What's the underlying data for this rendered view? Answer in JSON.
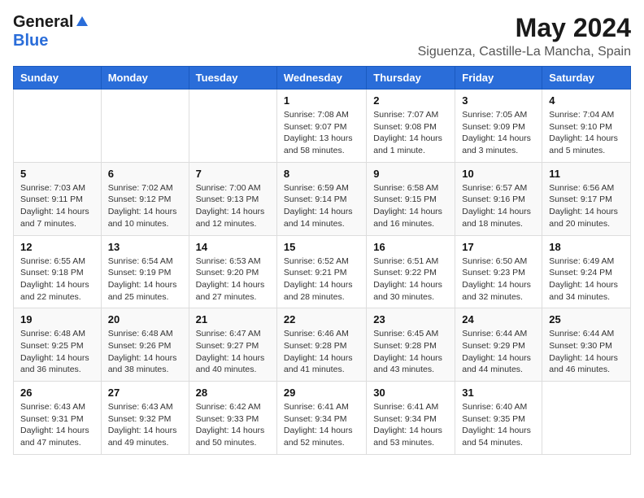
{
  "header": {
    "logo_general": "General",
    "logo_blue": "Blue",
    "month": "May 2024",
    "location": "Siguenza, Castille-La Mancha, Spain"
  },
  "days_of_week": [
    "Sunday",
    "Monday",
    "Tuesday",
    "Wednesday",
    "Thursday",
    "Friday",
    "Saturday"
  ],
  "weeks": [
    [
      {
        "day": "",
        "sunrise": "",
        "sunset": "",
        "daylight": ""
      },
      {
        "day": "",
        "sunrise": "",
        "sunset": "",
        "daylight": ""
      },
      {
        "day": "",
        "sunrise": "",
        "sunset": "",
        "daylight": ""
      },
      {
        "day": "1",
        "sunrise": "Sunrise: 7:08 AM",
        "sunset": "Sunset: 9:07 PM",
        "daylight": "Daylight: 13 hours and 58 minutes."
      },
      {
        "day": "2",
        "sunrise": "Sunrise: 7:07 AM",
        "sunset": "Sunset: 9:08 PM",
        "daylight": "Daylight: 14 hours and 1 minute."
      },
      {
        "day": "3",
        "sunrise": "Sunrise: 7:05 AM",
        "sunset": "Sunset: 9:09 PM",
        "daylight": "Daylight: 14 hours and 3 minutes."
      },
      {
        "day": "4",
        "sunrise": "Sunrise: 7:04 AM",
        "sunset": "Sunset: 9:10 PM",
        "daylight": "Daylight: 14 hours and 5 minutes."
      }
    ],
    [
      {
        "day": "5",
        "sunrise": "Sunrise: 7:03 AM",
        "sunset": "Sunset: 9:11 PM",
        "daylight": "Daylight: 14 hours and 7 minutes."
      },
      {
        "day": "6",
        "sunrise": "Sunrise: 7:02 AM",
        "sunset": "Sunset: 9:12 PM",
        "daylight": "Daylight: 14 hours and 10 minutes."
      },
      {
        "day": "7",
        "sunrise": "Sunrise: 7:00 AM",
        "sunset": "Sunset: 9:13 PM",
        "daylight": "Daylight: 14 hours and 12 minutes."
      },
      {
        "day": "8",
        "sunrise": "Sunrise: 6:59 AM",
        "sunset": "Sunset: 9:14 PM",
        "daylight": "Daylight: 14 hours and 14 minutes."
      },
      {
        "day": "9",
        "sunrise": "Sunrise: 6:58 AM",
        "sunset": "Sunset: 9:15 PM",
        "daylight": "Daylight: 14 hours and 16 minutes."
      },
      {
        "day": "10",
        "sunrise": "Sunrise: 6:57 AM",
        "sunset": "Sunset: 9:16 PM",
        "daylight": "Daylight: 14 hours and 18 minutes."
      },
      {
        "day": "11",
        "sunrise": "Sunrise: 6:56 AM",
        "sunset": "Sunset: 9:17 PM",
        "daylight": "Daylight: 14 hours and 20 minutes."
      }
    ],
    [
      {
        "day": "12",
        "sunrise": "Sunrise: 6:55 AM",
        "sunset": "Sunset: 9:18 PM",
        "daylight": "Daylight: 14 hours and 22 minutes."
      },
      {
        "day": "13",
        "sunrise": "Sunrise: 6:54 AM",
        "sunset": "Sunset: 9:19 PM",
        "daylight": "Daylight: 14 hours and 25 minutes."
      },
      {
        "day": "14",
        "sunrise": "Sunrise: 6:53 AM",
        "sunset": "Sunset: 9:20 PM",
        "daylight": "Daylight: 14 hours and 27 minutes."
      },
      {
        "day": "15",
        "sunrise": "Sunrise: 6:52 AM",
        "sunset": "Sunset: 9:21 PM",
        "daylight": "Daylight: 14 hours and 28 minutes."
      },
      {
        "day": "16",
        "sunrise": "Sunrise: 6:51 AM",
        "sunset": "Sunset: 9:22 PM",
        "daylight": "Daylight: 14 hours and 30 minutes."
      },
      {
        "day": "17",
        "sunrise": "Sunrise: 6:50 AM",
        "sunset": "Sunset: 9:23 PM",
        "daylight": "Daylight: 14 hours and 32 minutes."
      },
      {
        "day": "18",
        "sunrise": "Sunrise: 6:49 AM",
        "sunset": "Sunset: 9:24 PM",
        "daylight": "Daylight: 14 hours and 34 minutes."
      }
    ],
    [
      {
        "day": "19",
        "sunrise": "Sunrise: 6:48 AM",
        "sunset": "Sunset: 9:25 PM",
        "daylight": "Daylight: 14 hours and 36 minutes."
      },
      {
        "day": "20",
        "sunrise": "Sunrise: 6:48 AM",
        "sunset": "Sunset: 9:26 PM",
        "daylight": "Daylight: 14 hours and 38 minutes."
      },
      {
        "day": "21",
        "sunrise": "Sunrise: 6:47 AM",
        "sunset": "Sunset: 9:27 PM",
        "daylight": "Daylight: 14 hours and 40 minutes."
      },
      {
        "day": "22",
        "sunrise": "Sunrise: 6:46 AM",
        "sunset": "Sunset: 9:28 PM",
        "daylight": "Daylight: 14 hours and 41 minutes."
      },
      {
        "day": "23",
        "sunrise": "Sunrise: 6:45 AM",
        "sunset": "Sunset: 9:28 PM",
        "daylight": "Daylight: 14 hours and 43 minutes."
      },
      {
        "day": "24",
        "sunrise": "Sunrise: 6:44 AM",
        "sunset": "Sunset: 9:29 PM",
        "daylight": "Daylight: 14 hours and 44 minutes."
      },
      {
        "day": "25",
        "sunrise": "Sunrise: 6:44 AM",
        "sunset": "Sunset: 9:30 PM",
        "daylight": "Daylight: 14 hours and 46 minutes."
      }
    ],
    [
      {
        "day": "26",
        "sunrise": "Sunrise: 6:43 AM",
        "sunset": "Sunset: 9:31 PM",
        "daylight": "Daylight: 14 hours and 47 minutes."
      },
      {
        "day": "27",
        "sunrise": "Sunrise: 6:43 AM",
        "sunset": "Sunset: 9:32 PM",
        "daylight": "Daylight: 14 hours and 49 minutes."
      },
      {
        "day": "28",
        "sunrise": "Sunrise: 6:42 AM",
        "sunset": "Sunset: 9:33 PM",
        "daylight": "Daylight: 14 hours and 50 minutes."
      },
      {
        "day": "29",
        "sunrise": "Sunrise: 6:41 AM",
        "sunset": "Sunset: 9:34 PM",
        "daylight": "Daylight: 14 hours and 52 minutes."
      },
      {
        "day": "30",
        "sunrise": "Sunrise: 6:41 AM",
        "sunset": "Sunset: 9:34 PM",
        "daylight": "Daylight: 14 hours and 53 minutes."
      },
      {
        "day": "31",
        "sunrise": "Sunrise: 6:40 AM",
        "sunset": "Sunset: 9:35 PM",
        "daylight": "Daylight: 14 hours and 54 minutes."
      },
      {
        "day": "",
        "sunrise": "",
        "sunset": "",
        "daylight": ""
      }
    ]
  ]
}
